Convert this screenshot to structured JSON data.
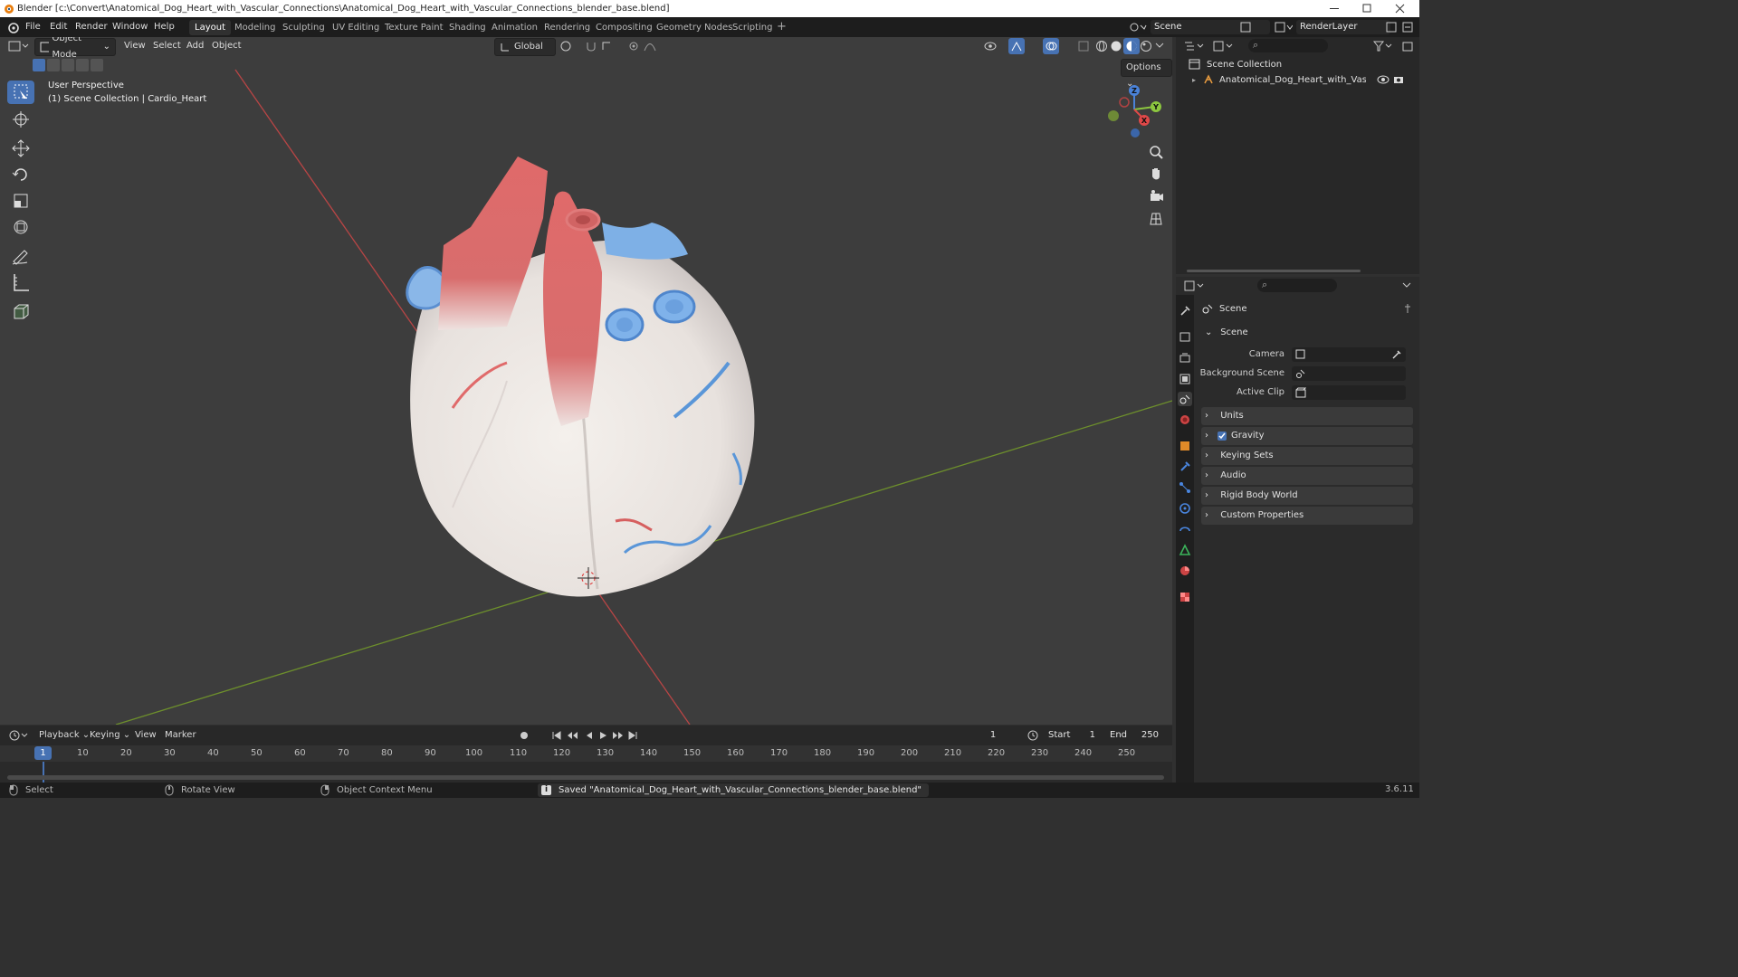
{
  "window": {
    "title": "Blender [c:\\Convert\\Anatomical_Dog_Heart_with_Vascular_Connections\\Anatomical_Dog_Heart_with_Vascular_Connections_blender_base.blend]"
  },
  "menu": [
    "File",
    "Edit",
    "Render",
    "Window",
    "Help"
  ],
  "workspaces": [
    "Layout",
    "Modeling",
    "Sculpting",
    "UV Editing",
    "Texture Paint",
    "Shading",
    "Animation",
    "Rendering",
    "Compositing",
    "Geometry Nodes",
    "Scripting"
  ],
  "topbar": {
    "scene": "Scene",
    "view_layer": "RenderLayer"
  },
  "viewport": {
    "mode": "Object Mode",
    "menus": [
      "View",
      "Select",
      "Add",
      "Object"
    ],
    "transform_orientation": "Global",
    "options_label": "Options",
    "overlay_line1": "User Perspective",
    "overlay_line2": "(1) Scene Collection | Cardio_Heart",
    "gizmo": {
      "z": "Z",
      "y": "Y",
      "x": "X"
    }
  },
  "timeline": {
    "menus": [
      "Playback",
      "Keying",
      "View",
      "Marker"
    ],
    "current_frame": "1",
    "start_label": "Start",
    "start": "1",
    "end_label": "End",
    "end": "250",
    "ticks": [
      "10",
      "20",
      "30",
      "40",
      "50",
      "60",
      "70",
      "80",
      "90",
      "100",
      "110",
      "120",
      "130",
      "140",
      "150",
      "160",
      "170",
      "180",
      "190",
      "200",
      "210",
      "220",
      "230",
      "240",
      "250"
    ],
    "cursor_label": "1"
  },
  "statusbar": {
    "select": "Select",
    "rotate": "Rotate View",
    "context": "Object Context Menu",
    "message": "Saved \"Anatomical_Dog_Heart_with_Vascular_Connections_blender_base.blend\"",
    "version": "3.6.11"
  },
  "outliner": {
    "root": "Scene Collection",
    "item": "Anatomical_Dog_Heart_with_Vascular_("
  },
  "properties": {
    "context": "Scene",
    "panel_scene": "Scene",
    "camera_label": "Camera",
    "background_scene_label": "Background Scene",
    "active_clip_label": "Active Clip",
    "panels": [
      "Units",
      "Gravity",
      "Keying Sets",
      "Audio",
      "Rigid Body World",
      "Custom Properties"
    ],
    "gravity_checked": true
  },
  "colors": {
    "accent": "#4772b3",
    "axis_x": "#e04848",
    "axis_y": "#8cc63f",
    "axis_z": "#4a82d8"
  }
}
